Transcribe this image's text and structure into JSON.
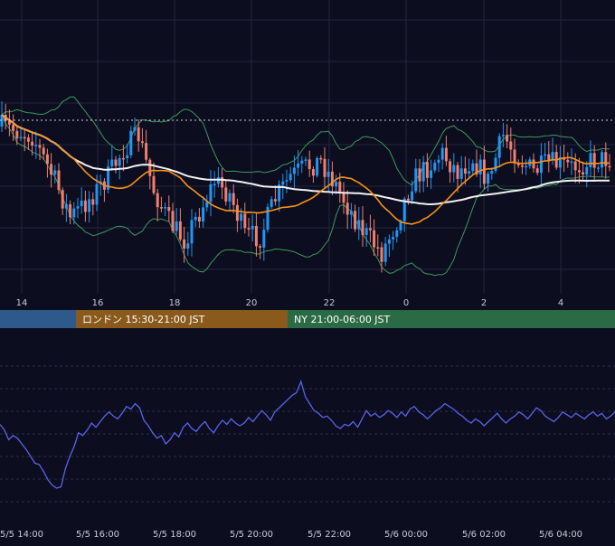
{
  "colors": {
    "background": "#0c0d1f",
    "grid": "#22263d",
    "bull_candle": "#2196f3",
    "bear_candle": "#ef7f6e",
    "ma_short": "#f7931a",
    "ma_long": "#f2f2f2",
    "bollinger": "#3b9a5c",
    "oscillator": "#5b63e8",
    "session_tokyo": "#2d5a8a",
    "session_london": "#8a5a1c",
    "session_ny": "#2a6a44"
  },
  "sessions": [
    {
      "label": ""
    },
    {
      "label": "ロンドン 15:30-21:00 JST"
    },
    {
      "label": "NY 21:00-06:00 JST"
    }
  ],
  "chart_data": [
    {
      "type": "candlestick",
      "title": "",
      "x_tick_labels": [
        "14",
        "16",
        "18",
        "20",
        "22",
        "0",
        "2",
        "4"
      ],
      "overlays": [
        "moving average (orange)",
        "moving average (white)",
        "Bollinger bands (green)"
      ],
      "reference_line": "dotted horizontal line near recent highs",
      "grid": true
    },
    {
      "type": "line",
      "title": "",
      "x_tick_labels": [
        "5/5 14:00",
        "5/5 16:00",
        "5/5 18:00",
        "5/5 20:00",
        "5/5 22:00",
        "5/6 00:00",
        "5/6 02:00",
        "5/6 04:00"
      ],
      "grid": true,
      "values": [
        54,
        50,
        43,
        46,
        44,
        40,
        36,
        31,
        26,
        25,
        20,
        14,
        10,
        8,
        9,
        22,
        31,
        38,
        48,
        46,
        50,
        55,
        52,
        56,
        60,
        63,
        60,
        58,
        62,
        67,
        65,
        69,
        66,
        57,
        53,
        48,
        44,
        46,
        40,
        43,
        48,
        45,
        52,
        55,
        51,
        49,
        53,
        56,
        51,
        48,
        53,
        57,
        54,
        58,
        55,
        53,
        55,
        59,
        56,
        60,
        64,
        61,
        57,
        63,
        66,
        69,
        72,
        75,
        77,
        85,
        74,
        69,
        64,
        62,
        59,
        60,
        57,
        53,
        51,
        54,
        53,
        56,
        52,
        58,
        64,
        60,
        62,
        59,
        61,
        64,
        62,
        59,
        63,
        60,
        65,
        67,
        63,
        61,
        58,
        61,
        64,
        66,
        69,
        67,
        65,
        62,
        60,
        57,
        55,
        58,
        56,
        53,
        56,
        59,
        62,
        58,
        55,
        58,
        60,
        63,
        61,
        58,
        62,
        66,
        64,
        60,
        58,
        56,
        59,
        63,
        61,
        59,
        62,
        60,
        58,
        61,
        63,
        60,
        62,
        58,
        60,
        63
      ]
    }
  ]
}
